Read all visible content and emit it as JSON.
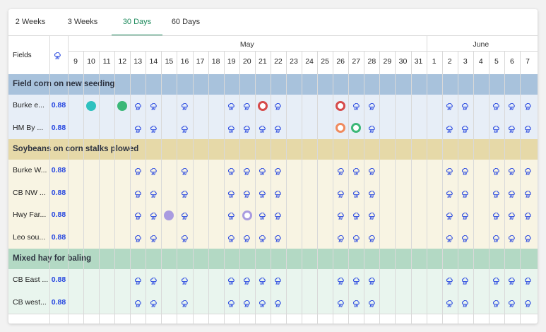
{
  "tabs": [
    {
      "label": "2 Weeks",
      "active": false
    },
    {
      "label": "3 Weeks",
      "active": false
    },
    {
      "label": "30 Days",
      "active": true
    },
    {
      "label": "60 Days",
      "active": false
    }
  ],
  "header": {
    "fields_label": "Fields",
    "rain_icon": "rain-icon",
    "months": [
      "May",
      "June"
    ],
    "days": [
      "9",
      "10",
      "11",
      "12",
      "13",
      "14",
      "15",
      "16",
      "17",
      "18",
      "19",
      "20",
      "21",
      "22",
      "23",
      "24",
      "25",
      "26",
      "27",
      "28",
      "29",
      "30",
      "31",
      "1",
      "2",
      "3",
      "4",
      "5",
      "6",
      "7"
    ]
  },
  "colors": {
    "accent": "#1d8a5c",
    "value": "#2747e0",
    "rain": "#2747e0"
  },
  "groups": [
    {
      "name": "Field corn on new seeding",
      "header_color": "#a8c2dc",
      "row_color": "#e7eef7",
      "rows": [
        {
          "label": "Burke e...",
          "value": "0.88",
          "rain_days": [
            13,
            14,
            16,
            19,
            20,
            22,
            27,
            28,
            33,
            34,
            36,
            37,
            38
          ],
          "events": [
            {
              "day": 10,
              "fill": "#2ec1bf",
              "ring": ""
            },
            {
              "day": 12,
              "fill": "#3cb878",
              "ring": ""
            },
            {
              "day": 21,
              "fill": "#ffffff",
              "ring": "#d64a4a"
            },
            {
              "day": 26,
              "fill": "#ffffff",
              "ring": "#d64a4a"
            }
          ]
        },
        {
          "label": "HM By ...",
          "value": "0.88",
          "rain_days": [
            13,
            14,
            16,
            19,
            20,
            21,
            22,
            28,
            33,
            34,
            36,
            37,
            38
          ],
          "events": [
            {
              "day": 26,
              "fill": "#ffffff",
              "ring": "#f08a5d"
            },
            {
              "day": 27,
              "fill": "#ffffff",
              "ring": "#3cb878"
            }
          ]
        }
      ]
    },
    {
      "name": "Soybeans on corn stalks plowed",
      "header_color": "#e6d9a8",
      "row_color": "#f8f4e3",
      "rows": [
        {
          "label": "Burke W...",
          "value": "0.88",
          "rain_days": [
            13,
            14,
            16,
            19,
            20,
            21,
            22,
            26,
            27,
            28,
            33,
            34,
            36,
            37,
            38
          ],
          "events": []
        },
        {
          "label": "CB NW ...",
          "value": "0.88",
          "rain_days": [
            13,
            14,
            16,
            19,
            20,
            21,
            22,
            26,
            27,
            28,
            33,
            34,
            36,
            37,
            38
          ],
          "events": []
        },
        {
          "label": "Hwy Far...",
          "value": "0.88",
          "rain_days": [
            13,
            14,
            16,
            19,
            21,
            22,
            26,
            27,
            28,
            33,
            34,
            36,
            37,
            38
          ],
          "events": [
            {
              "day": 15,
              "fill": "#a99be0",
              "ring": ""
            },
            {
              "day": 20,
              "fill": "#ffffff",
              "ring": "#a99be0"
            }
          ]
        },
        {
          "label": "Leo sou...",
          "value": "0.88",
          "rain_days": [
            13,
            14,
            16,
            19,
            20,
            21,
            22,
            26,
            27,
            28,
            33,
            34,
            36,
            37,
            38
          ],
          "events": []
        }
      ]
    },
    {
      "name": "Mixed hay for baling",
      "header_color": "#b3d9c4",
      "row_color": "#e9f5ee",
      "rows": [
        {
          "label": "CB East ...",
          "value": "0.88",
          "rain_days": [
            13,
            14,
            16,
            19,
            20,
            21,
            22,
            26,
            27,
            28,
            33,
            34,
            36,
            37,
            38
          ],
          "events": []
        },
        {
          "label": "CB west...",
          "value": "0.88",
          "rain_days": [
            13,
            14,
            16,
            19,
            20,
            21,
            22,
            26,
            27,
            28,
            33,
            34,
            36,
            37,
            38
          ],
          "events": []
        }
      ]
    }
  ]
}
